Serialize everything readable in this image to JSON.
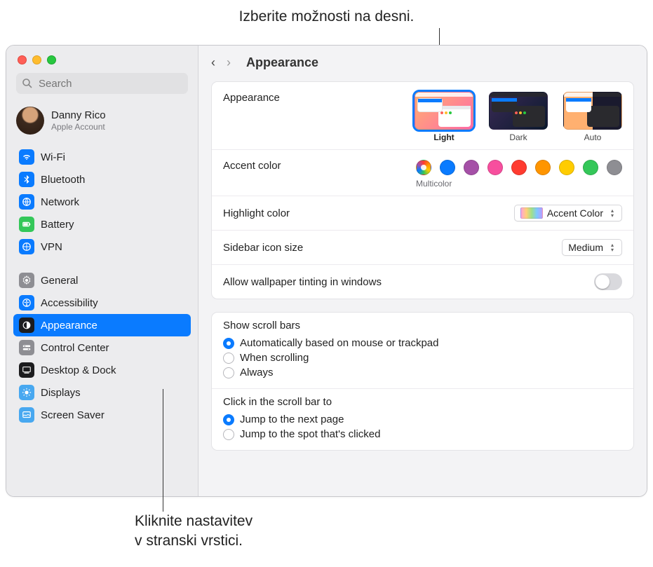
{
  "callouts": {
    "top": "Izberite možnosti na desni.",
    "bottom_line1": "Kliknite nastavitev",
    "bottom_line2": "v stranski vrstici."
  },
  "search": {
    "placeholder": "Search"
  },
  "account": {
    "name": "Danny Rico",
    "sub": "Apple Account"
  },
  "sidebar": {
    "group1": [
      {
        "label": "Wi-Fi"
      },
      {
        "label": "Bluetooth"
      },
      {
        "label": "Network"
      },
      {
        "label": "Battery"
      },
      {
        "label": "VPN"
      }
    ],
    "group2": [
      {
        "label": "General"
      },
      {
        "label": "Accessibility"
      },
      {
        "label": "Appearance"
      },
      {
        "label": "Control Center"
      },
      {
        "label": "Desktop & Dock"
      },
      {
        "label": "Displays"
      },
      {
        "label": "Screen Saver"
      }
    ]
  },
  "page": {
    "title": "Appearance"
  },
  "appearance_section": {
    "label": "Appearance",
    "options": {
      "light": "Light",
      "dark": "Dark",
      "auto": "Auto"
    }
  },
  "accent": {
    "label": "Accent color",
    "selected_name": "Multicolor",
    "colors": [
      "multicolor",
      "#0a7bff",
      "#a550a7",
      "#f74f9e",
      "#ff3b30",
      "#ff9500",
      "#ffcc00",
      "#34c759",
      "#8e8e93"
    ]
  },
  "highlight": {
    "label": "Highlight color",
    "value": "Accent Color"
  },
  "icon_size": {
    "label": "Sidebar icon size",
    "value": "Medium"
  },
  "tinting": {
    "label": "Allow wallpaper tinting in windows"
  },
  "scrollbars": {
    "title": "Show scroll bars",
    "opts": [
      "Automatically based on mouse or trackpad",
      "When scrolling",
      "Always"
    ]
  },
  "click_scroll": {
    "title": "Click in the scroll bar to",
    "opts": [
      "Jump to the next page",
      "Jump to the spot that's clicked"
    ]
  }
}
